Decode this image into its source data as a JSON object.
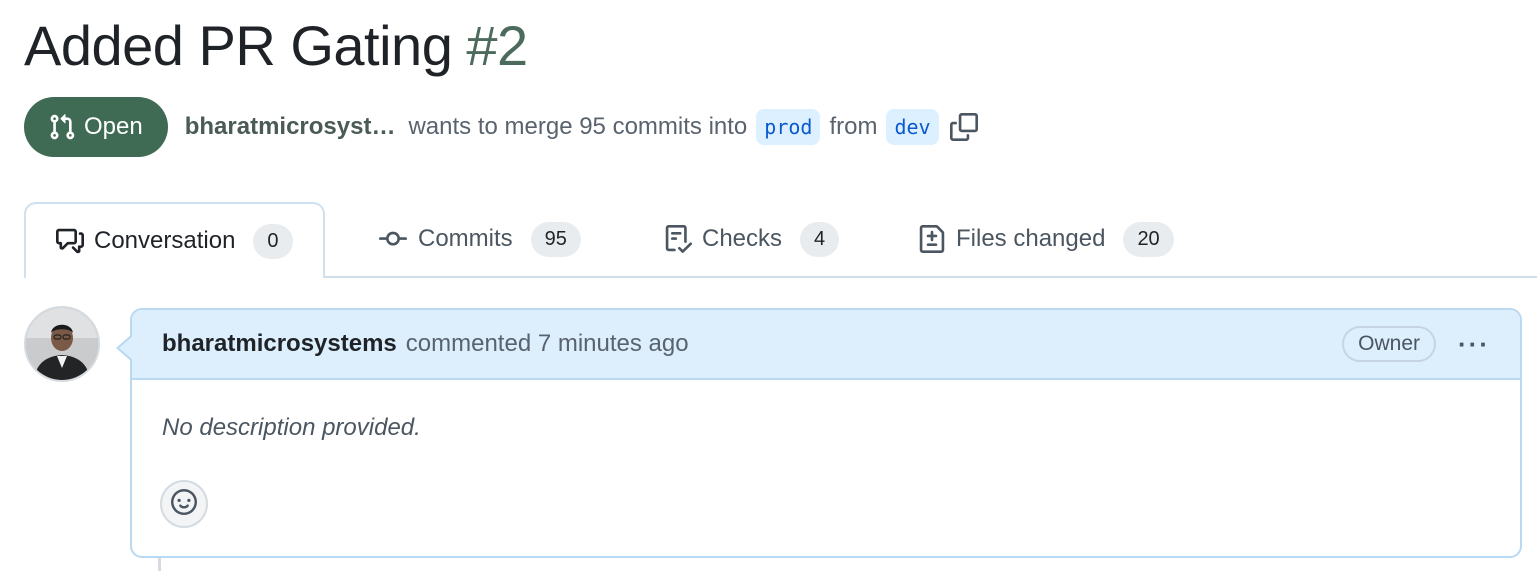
{
  "pr": {
    "title": "Added PR Gating",
    "number": "#2",
    "state": "Open",
    "author_short": "bharatmicrosyst…",
    "merge_text": "wants to merge 95 commits into",
    "base_branch": "prod",
    "from_text": "from",
    "head_branch": "dev"
  },
  "tabs": [
    {
      "label": "Conversation",
      "count": "0",
      "icon": "conversation-icon"
    },
    {
      "label": "Commits",
      "count": "95",
      "icon": "commit-icon"
    },
    {
      "label": "Checks",
      "count": "4",
      "icon": "checklist-icon"
    },
    {
      "label": "Files changed",
      "count": "20",
      "icon": "file-diff-icon"
    }
  ],
  "comment": {
    "author": "bharatmicrosystems",
    "action": "commented 7 minutes ago",
    "role": "Owner",
    "body": "No description provided."
  },
  "colors": {
    "open_green": "#3f6b55",
    "branch_bg": "#ddf0ff",
    "branch_fg": "#0b59d0",
    "comment_header_bg": "#ddeffd"
  }
}
